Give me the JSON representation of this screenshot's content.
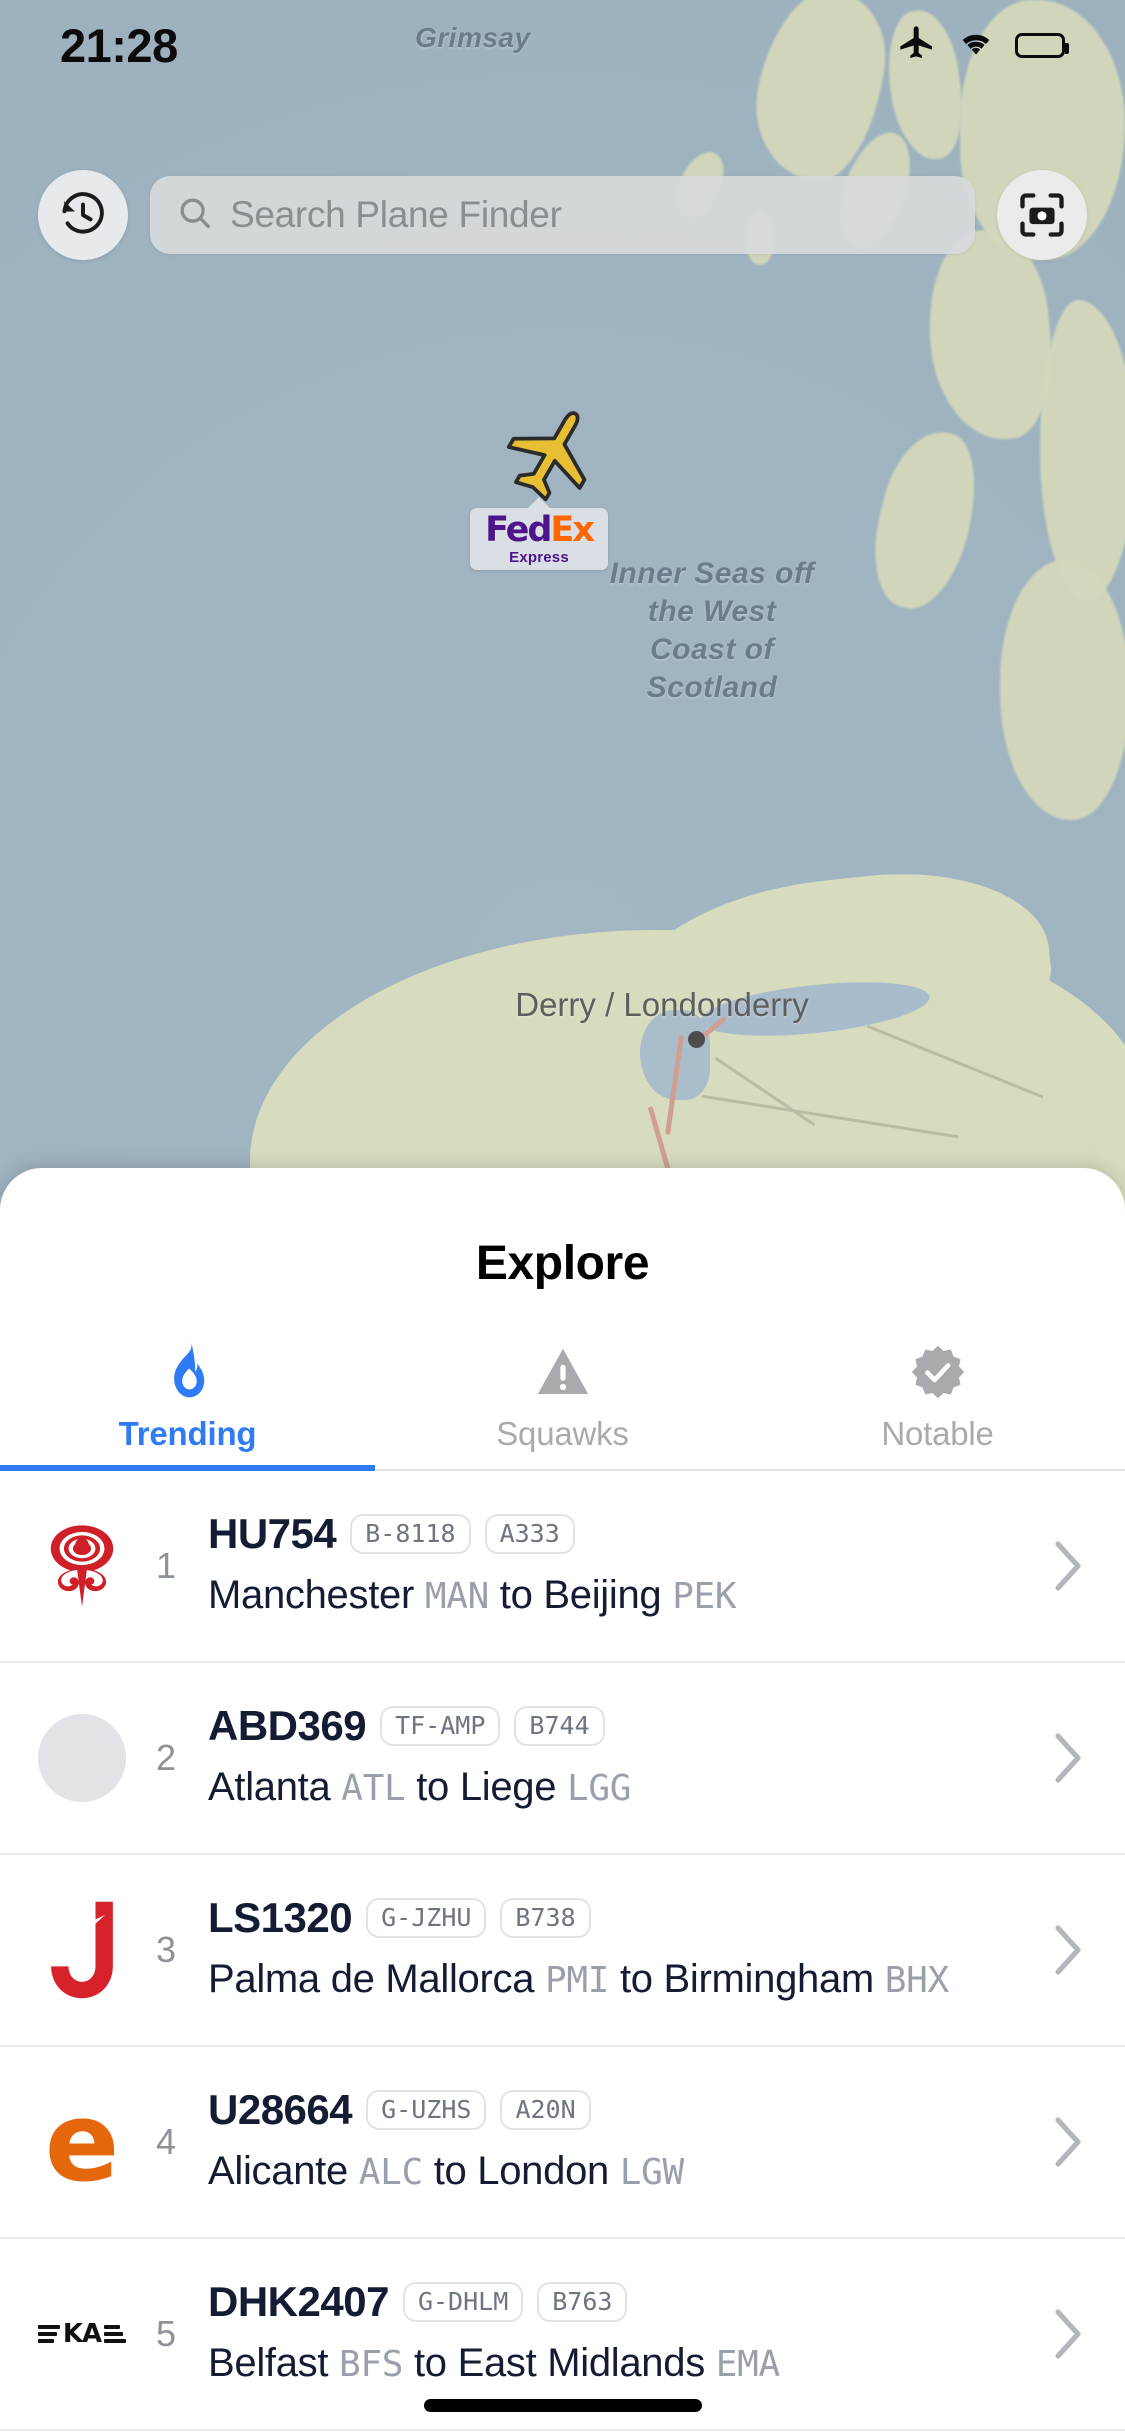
{
  "status_bar": {
    "time": "21:28",
    "icons": [
      "airplane-mode-icon",
      "wifi-icon",
      "battery-icon"
    ]
  },
  "map": {
    "labels": {
      "grimsay": "Grimsay",
      "sea_area": "Inner Seas off the West Coast of Scotland",
      "city": "Derry / Londonderry"
    },
    "aircraft_marker": {
      "icon": "airplane-icon",
      "color": "#E8BE32",
      "heading_deg": 30
    },
    "flight_callout": {
      "airline": "FedEx Express",
      "wordmark_part1": "Fed",
      "wordmark_part2": "Ex",
      "wordmark_sub": "Express",
      "colors": {
        "purple": "#4D148C",
        "orange": "#FF6600"
      }
    }
  },
  "search": {
    "placeholder": "Search Plane Finder",
    "value": "",
    "left_button_icon": "history-clock-icon",
    "right_button_icon": "camera-scan-icon",
    "search_icon": "search-icon"
  },
  "sheet": {
    "title": "Explore",
    "tabs": [
      {
        "label": "Trending",
        "icon": "flame-icon",
        "active": true
      },
      {
        "label": "Squawks",
        "icon": "warning-triangle-icon",
        "active": false
      },
      {
        "label": "Notable",
        "icon": "verified-check-badge-icon",
        "active": false
      }
    ],
    "accent_color": "#2F7BF6",
    "inactive_color": "#A8AAAD"
  },
  "flights": [
    {
      "rank": "1",
      "callsign": "HU754",
      "registration": "B-8118",
      "aircraft_type": "A333",
      "origin_city": "Manchester",
      "origin_code": "MAN",
      "connector": "to",
      "dest_city": "Beijing",
      "dest_code": "PEK",
      "airline_logo": "hainan-airlines-logo",
      "logo_color": "#CF2027"
    },
    {
      "rank": "2",
      "callsign": "ABD369",
      "registration": "TF-AMP",
      "aircraft_type": "B744",
      "origin_city": "Atlanta",
      "origin_code": "ATL",
      "connector": "to",
      "dest_city": "Liege",
      "dest_code": "LGG",
      "airline_logo": "placeholder-logo",
      "logo_color": "#E2E3E6"
    },
    {
      "rank": "3",
      "callsign": "LS1320",
      "registration": "G-JZHU",
      "aircraft_type": "B738",
      "origin_city": "Palma de Mallorca",
      "origin_code": "PMI",
      "connector": "to",
      "dest_city": "Birmingham",
      "dest_code": "BHX",
      "airline_logo": "jet2-logo",
      "logo_color": "#D7222B"
    },
    {
      "rank": "4",
      "callsign": "U28664",
      "registration": "G-UZHS",
      "aircraft_type": "A20N",
      "origin_city": "Alicante",
      "origin_code": "ALC",
      "connector": "to",
      "dest_city": "London",
      "dest_code": "LGW",
      "airline_logo": "easyjet-logo",
      "logo_color": "#E4670B"
    },
    {
      "rank": "5",
      "callsign": "DHK2407",
      "registration": "G-DHLM",
      "aircraft_type": "B763",
      "origin_city": "Belfast",
      "origin_code": "BFS",
      "connector": "to",
      "dest_city": "East Midlands",
      "dest_code": "EMA",
      "airline_logo": "dhl-air-logo",
      "logo_color": "#111111"
    }
  ],
  "chevron_icon": "chevron-right-icon"
}
